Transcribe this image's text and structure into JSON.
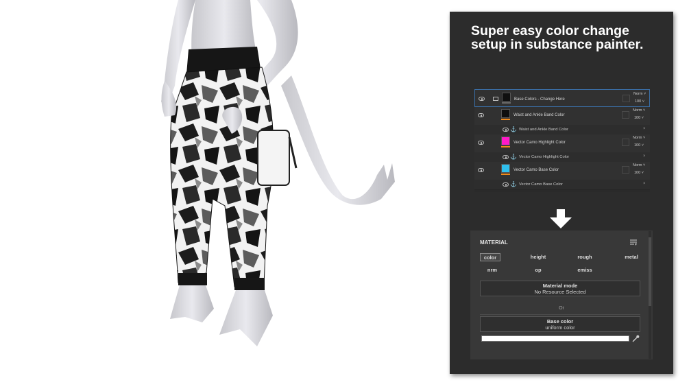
{
  "headline": {
    "line1": "Super easy color change",
    "line2": "setup in substance painter."
  },
  "layers": [
    {
      "name": "Base Colors - Change Here",
      "type": "folder",
      "blend": "Norm",
      "opacity": "100",
      "thumb_color": "#101010",
      "bar_color": "#6a6a6a",
      "selected": true,
      "mask": null
    },
    {
      "name": "Waist and Ankle Band Color",
      "type": "fill",
      "blend": "Norm",
      "opacity": "100",
      "thumb_color": "#0e0e0e",
      "bar_color": "#f08a1a",
      "selected": false,
      "mask": "Waist and Ankle Band Color"
    },
    {
      "name": "Vector Camo Highlight Color",
      "type": "fill",
      "blend": "Norm",
      "opacity": "100",
      "thumb_color": "#ff19c8",
      "bar_color": "#f08a1a",
      "selected": false,
      "mask": "Vector Camo Highlight Color"
    },
    {
      "name": "Vector Camo Base Color",
      "type": "fill",
      "blend": "Norm",
      "opacity": "100",
      "thumb_color": "#2fc0ee",
      "bar_color": "#f08a1a",
      "selected": false,
      "mask": "Vector Camo Base Color"
    }
  ],
  "material": {
    "title": "MATERIAL",
    "channels": [
      {
        "label": "color",
        "active": true
      },
      {
        "label": "height",
        "active": false
      },
      {
        "label": "rough",
        "active": false
      },
      {
        "label": "metal",
        "active": false
      },
      {
        "label": "nrm",
        "active": false
      },
      {
        "label": "op",
        "active": false
      },
      {
        "label": "emiss",
        "active": false
      }
    ],
    "material_mode_label": "Material mode",
    "material_mode_value": "No Resource Selected",
    "or_label": "Or",
    "base_color_label": "Base color",
    "base_color_value": "uniform color",
    "base_color_swatch": "#ffffff"
  },
  "icons": {
    "eye": "eye-icon",
    "folder": "folder-icon",
    "anchor": "anchor-icon",
    "menu": "menu-icon",
    "picker": "color-picker-icon",
    "arrow": "down-arrow-icon"
  },
  "colors": {
    "panel_bg": "#2c2c2c",
    "material_bg": "#383838",
    "selection": "#3a6ea5",
    "accent_orange": "#f08a1a"
  }
}
